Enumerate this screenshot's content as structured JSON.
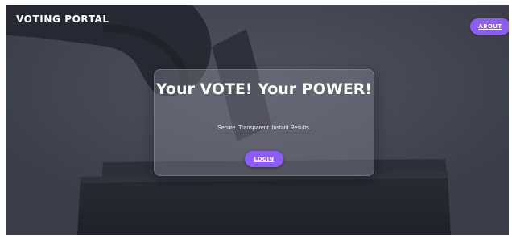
{
  "header": {
    "brand": "VOTING PORTAL",
    "about_label": "ABOUT"
  },
  "hero": {
    "title": "Your VOTE! Your POWER!",
    "subtitle": "Secure. Transparent. Instant Results.",
    "login_label": "LOGIN"
  },
  "theme": {
    "accent": "#8b5cf6",
    "background": "#41444f",
    "text": "#ffffff"
  },
  "background_image": {
    "subject": "hand dropping ballot into ballot box"
  }
}
